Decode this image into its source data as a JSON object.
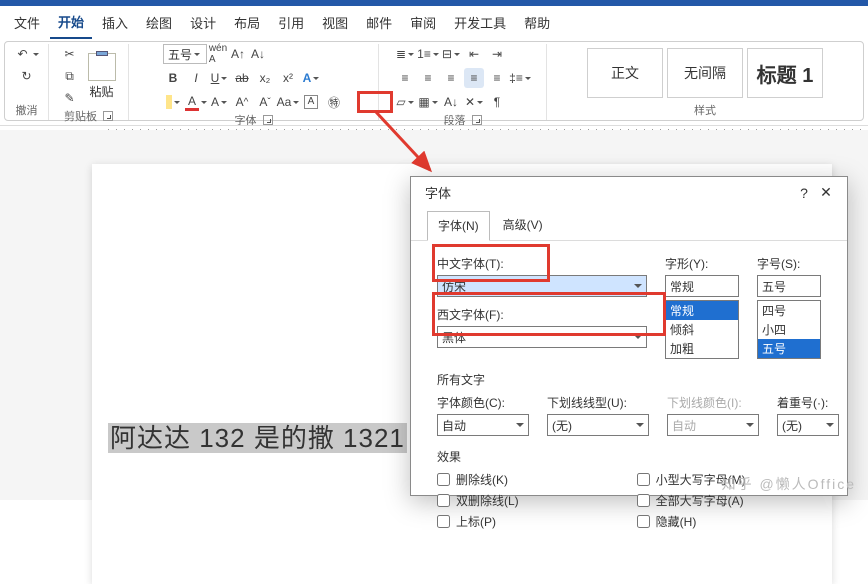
{
  "menu": {
    "items": [
      "文件",
      "开始",
      "插入",
      "绘图",
      "设计",
      "布局",
      "引用",
      "视图",
      "邮件",
      "审阅",
      "开发工具",
      "帮助"
    ],
    "active": 1
  },
  "ribbon": {
    "undo_label": "撤消",
    "clipboard_label": "剪贴板",
    "paste_label": "粘贴",
    "font_label": "字体",
    "font_size_value": "五号",
    "para_label": "段落",
    "styles_label": "样式",
    "style1": "正文",
    "style2": "无间隔",
    "style3": "标题 1"
  },
  "doc": {
    "selected_text": "阿达达 132 是的撒 1321"
  },
  "dialog": {
    "title": "字体",
    "help": "?",
    "close": "✕",
    "tab_font": "字体(N)",
    "tab_adv": "高级(V)",
    "cn_font_label": "中文字体(T):",
    "cn_font_value": "仿宋",
    "west_font_label": "西文字体(F):",
    "west_font_value": "黑体",
    "style_label": "字形(Y):",
    "style_value": "常规",
    "style_opts": [
      "常规",
      "倾斜",
      "加粗"
    ],
    "size_label": "字号(S):",
    "size_value": "五号",
    "size_opts": [
      "四号",
      "小四",
      "五号"
    ],
    "all_text": "所有文字",
    "font_color_label": "字体颜色(C):",
    "font_color_value": "自动",
    "ul_style_label": "下划线线型(U):",
    "ul_style_value": "(无)",
    "ul_color_label": "下划线颜色(I):",
    "ul_color_value": "自动",
    "emph_label": "着重号(·):",
    "emph_value": "(无)",
    "effects": "效果",
    "cb_strike": "删除线(K)",
    "cb_dstrike": "双删除线(L)",
    "cb_super": "上标(P)",
    "cb_smallcaps": "小型大写字母(M)",
    "cb_allcaps": "全部大写字母(A)",
    "cb_hidden": "隐藏(H)"
  },
  "watermark": "知乎 @懒人Office"
}
